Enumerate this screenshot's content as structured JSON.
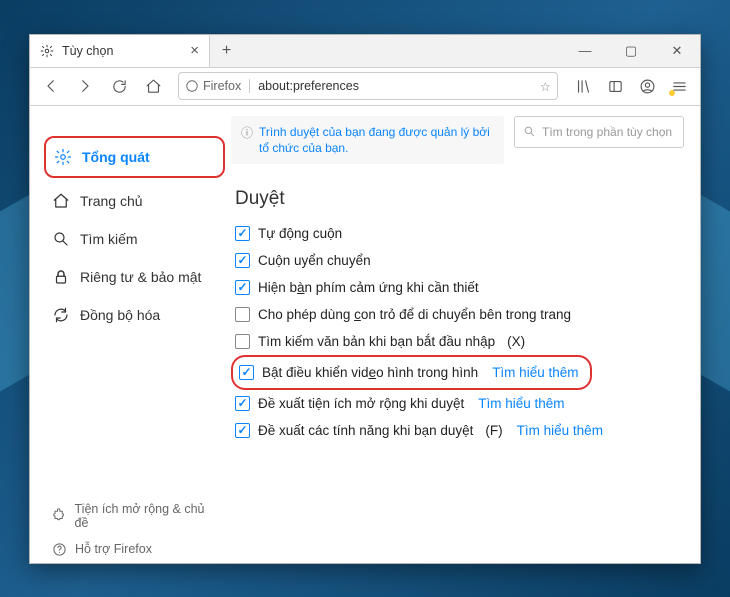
{
  "titlebar": {
    "tab_title": "Tùy chọn",
    "newtab_plus": "+"
  },
  "urlbar": {
    "brand": "Firefox",
    "url": "about:preferences"
  },
  "sidebar": {
    "items": [
      {
        "label": "Tổng quát",
        "icon": "gear",
        "active": true
      },
      {
        "label": "Trang chủ",
        "icon": "home",
        "active": false
      },
      {
        "label": "Tìm kiếm",
        "icon": "search",
        "active": false
      },
      {
        "label": "Riêng tư & bảo mật",
        "icon": "lock",
        "active": false
      },
      {
        "label": "Đồng bộ hóa",
        "icon": "sync",
        "active": false
      }
    ],
    "footer_ext": "Tiện ích mở rộng & chủ đề",
    "footer_support": "Hỗ trợ Firefox"
  },
  "main": {
    "notice": "Trình duyệt của bạn đang được quản lý bởi tổ chức của bạn.",
    "search_placeholder": "Tìm trong phần tùy chọn",
    "section_title": "Duyệt",
    "rows": [
      {
        "checked": true,
        "label": "Tự động cuộn"
      },
      {
        "checked": true,
        "label": "Cuộn uyển chuyển"
      },
      {
        "checked": true,
        "label": "Hiện bàn phím cảm ứng khi cần thiết"
      },
      {
        "checked": false,
        "label": "Cho phép dùng con trỏ để di chuyển bên trong trang"
      },
      {
        "checked": false,
        "label": "Tìm kiếm văn bản khi bạn bắt đầu nhập",
        "key": "X"
      },
      {
        "checked": true,
        "label": "Bật điều khiển video hình trong hình",
        "link": "Tìm hiểu thêm",
        "highlighted": true
      },
      {
        "checked": true,
        "label": "Đề xuất tiện ích mở rộng khi duyệt",
        "link": "Tìm hiểu thêm"
      },
      {
        "checked": true,
        "label": "Đề xuất các tính năng khi bạn duyệt",
        "key": "F",
        "link": "Tìm hiểu thêm"
      }
    ]
  }
}
